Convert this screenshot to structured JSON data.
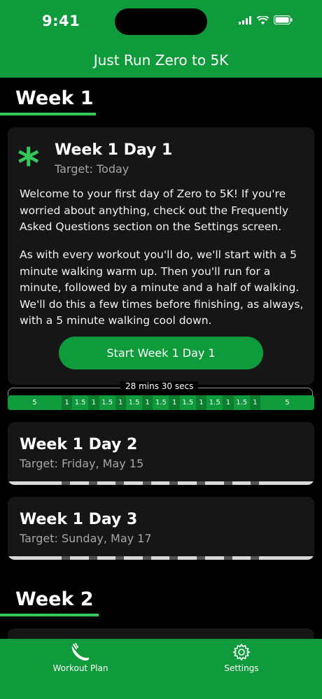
{
  "status_bar": {
    "time": "9:41"
  },
  "header": {
    "title": "Just Run Zero to 5K"
  },
  "weeks": [
    {
      "heading": "Week 1"
    },
    {
      "heading": "Week 2"
    }
  ],
  "day1": {
    "title": "Week 1 Day 1",
    "target": "Target: Today",
    "paragraph1": "Welcome to your first day of Zero to 5K! If you're worried about anything, check out the Frequently Asked Questions section on the Settings screen.",
    "paragraph2": "As with every workout you'll do, we'll start with a 5 minute walking warm up. Then you'll run for a minute, followed by a minute and a half of walking. We'll do this a few times before finishing, as always, with a 5 minute walking cool down.",
    "button_label": "Start Week 1 Day 1",
    "duration": "28 mins 30 secs",
    "segments": [
      {
        "label": "5",
        "minutes": 5,
        "kind": "walk"
      },
      {
        "label": "1",
        "minutes": 1,
        "kind": "run"
      },
      {
        "label": "1.5",
        "minutes": 1.5,
        "kind": "walk"
      },
      {
        "label": "1",
        "minutes": 1,
        "kind": "run"
      },
      {
        "label": "1.5",
        "minutes": 1.5,
        "kind": "walk"
      },
      {
        "label": "1",
        "minutes": 1,
        "kind": "run"
      },
      {
        "label": "1.5",
        "minutes": 1.5,
        "kind": "walk"
      },
      {
        "label": "1",
        "minutes": 1,
        "kind": "run"
      },
      {
        "label": "1.5",
        "minutes": 1.5,
        "kind": "walk"
      },
      {
        "label": "1",
        "minutes": 1,
        "kind": "run"
      },
      {
        "label": "1.5",
        "minutes": 1.5,
        "kind": "walk"
      },
      {
        "label": "1",
        "minutes": 1,
        "kind": "run"
      },
      {
        "label": "1.5",
        "minutes": 1.5,
        "kind": "walk"
      },
      {
        "label": "1",
        "minutes": 1,
        "kind": "run"
      },
      {
        "label": "1.5",
        "minutes": 1.5,
        "kind": "walk"
      },
      {
        "label": "1",
        "minutes": 1,
        "kind": "run"
      },
      {
        "label": "5",
        "minutes": 5,
        "kind": "walk"
      }
    ]
  },
  "day2": {
    "title": "Week 1 Day 2",
    "target": "Target: Friday, May 15"
  },
  "day3": {
    "title": "Week 1 Day 3",
    "target": "Target: Sunday, May 17"
  },
  "tabs": [
    {
      "label": "Workout Plan",
      "icon": "shoe-icon"
    },
    {
      "label": "Settings",
      "icon": "gear-icon"
    }
  ],
  "colors": {
    "accent": "#0f9a3c",
    "highlight": "#34c759",
    "card": "#161616"
  }
}
